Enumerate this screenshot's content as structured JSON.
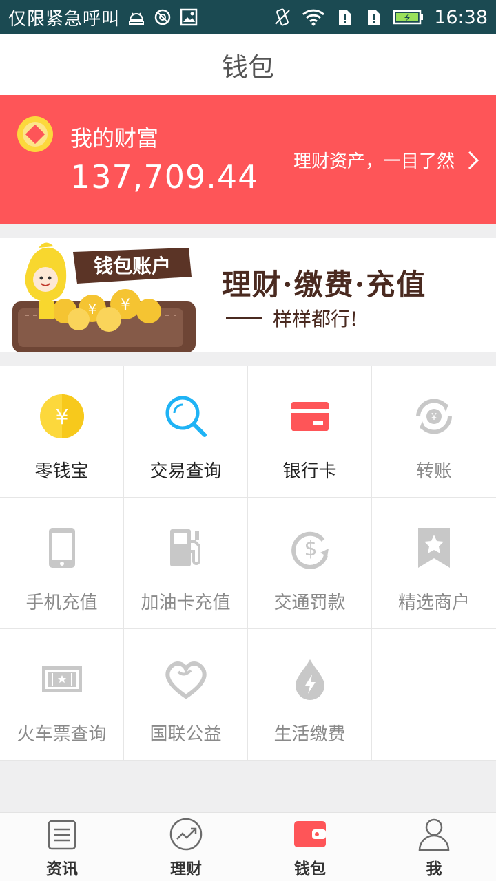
{
  "status_bar": {
    "notification": "仅限紧急呼叫",
    "time": "16:38",
    "battery_color": "#9ae05a"
  },
  "header": {
    "title": "钱包"
  },
  "wealth": {
    "label": "我的财富",
    "amount": "137,709.44",
    "link_text": "理财资产，一目了然",
    "background_color": "#fe5558"
  },
  "banner": {
    "badge_text": "钱包账户",
    "title": "理财·缴费·充值",
    "subtitle": "样样都行!"
  },
  "services": [
    {
      "label": "零钱宝",
      "icon": "yuan-coin-icon",
      "active": true
    },
    {
      "label": "交易查询",
      "icon": "search-icon",
      "active": true
    },
    {
      "label": "银行卡",
      "icon": "bank-card-icon",
      "active": true
    },
    {
      "label": "转账",
      "icon": "transfer-icon",
      "active": false
    },
    {
      "label": "手机充值",
      "icon": "phone-icon",
      "active": false
    },
    {
      "label": "加油卡充值",
      "icon": "fuel-pump-icon",
      "active": false
    },
    {
      "label": "交通罚款",
      "icon": "traffic-fine-icon",
      "active": false
    },
    {
      "label": "精选商户",
      "icon": "star-bookmark-icon",
      "active": false
    },
    {
      "label": "火车票查询",
      "icon": "train-ticket-icon",
      "active": false
    },
    {
      "label": "国联公益",
      "icon": "heart-icon",
      "active": false
    },
    {
      "label": "生活缴费",
      "icon": "utility-drop-icon",
      "active": false
    }
  ],
  "tab_bar": {
    "tabs": [
      {
        "label": "资讯",
        "icon": "news-icon"
      },
      {
        "label": "理财",
        "icon": "chart-icon"
      },
      {
        "label": "钱包",
        "icon": "wallet-icon",
        "selected": true
      },
      {
        "label": "我",
        "icon": "person-icon"
      }
    ]
  },
  "colors": {
    "accent": "#fe5558",
    "coin_yellow": "#fcd83c",
    "search_blue": "#1fb3f5",
    "inactive_icon": "#c8c8c8"
  }
}
